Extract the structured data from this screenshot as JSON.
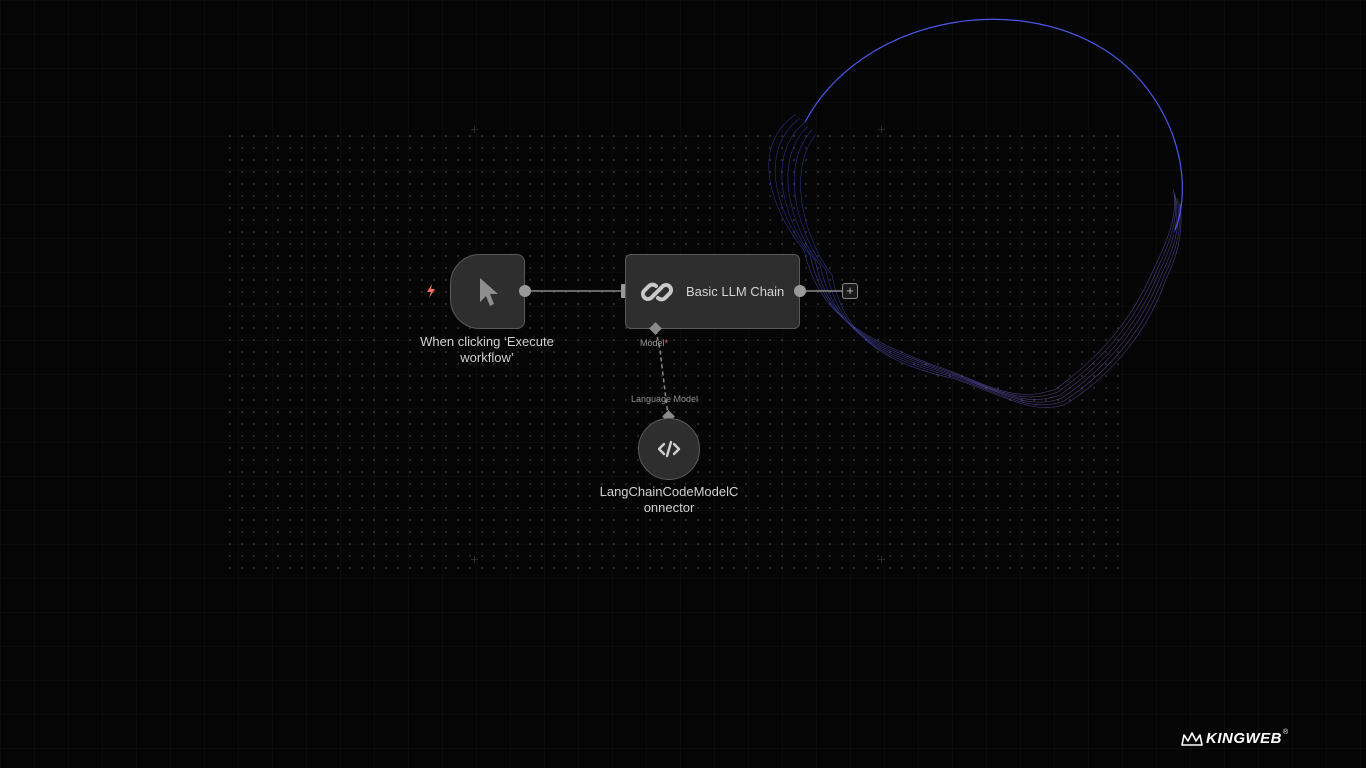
{
  "canvas": {
    "background": "#050505"
  },
  "nodes": {
    "trigger": {
      "label": "When clicking ‘Execute workflow’",
      "icon": "cursor-icon",
      "badge_icon": "bolt-icon",
      "badge_color": "#ff6d5a"
    },
    "chain": {
      "title": "Basic LLM Chain",
      "icon": "link-icon",
      "input_label": "Model",
      "input_required_mark": "*"
    },
    "model": {
      "label": "LangChainCodeModelConnector",
      "icon": "code-icon",
      "output_label": "Language Model"
    }
  },
  "actions": {
    "add_node_label": "+"
  },
  "branding": {
    "logo_text": "KINGWEB",
    "registered_mark": "®"
  },
  "colors": {
    "node_fill": "#2e2e2e",
    "node_border": "#5a5a5a",
    "wire": "#8a8a8a",
    "glow_start": "#5b6cff",
    "glow_end": "#a066d3"
  }
}
